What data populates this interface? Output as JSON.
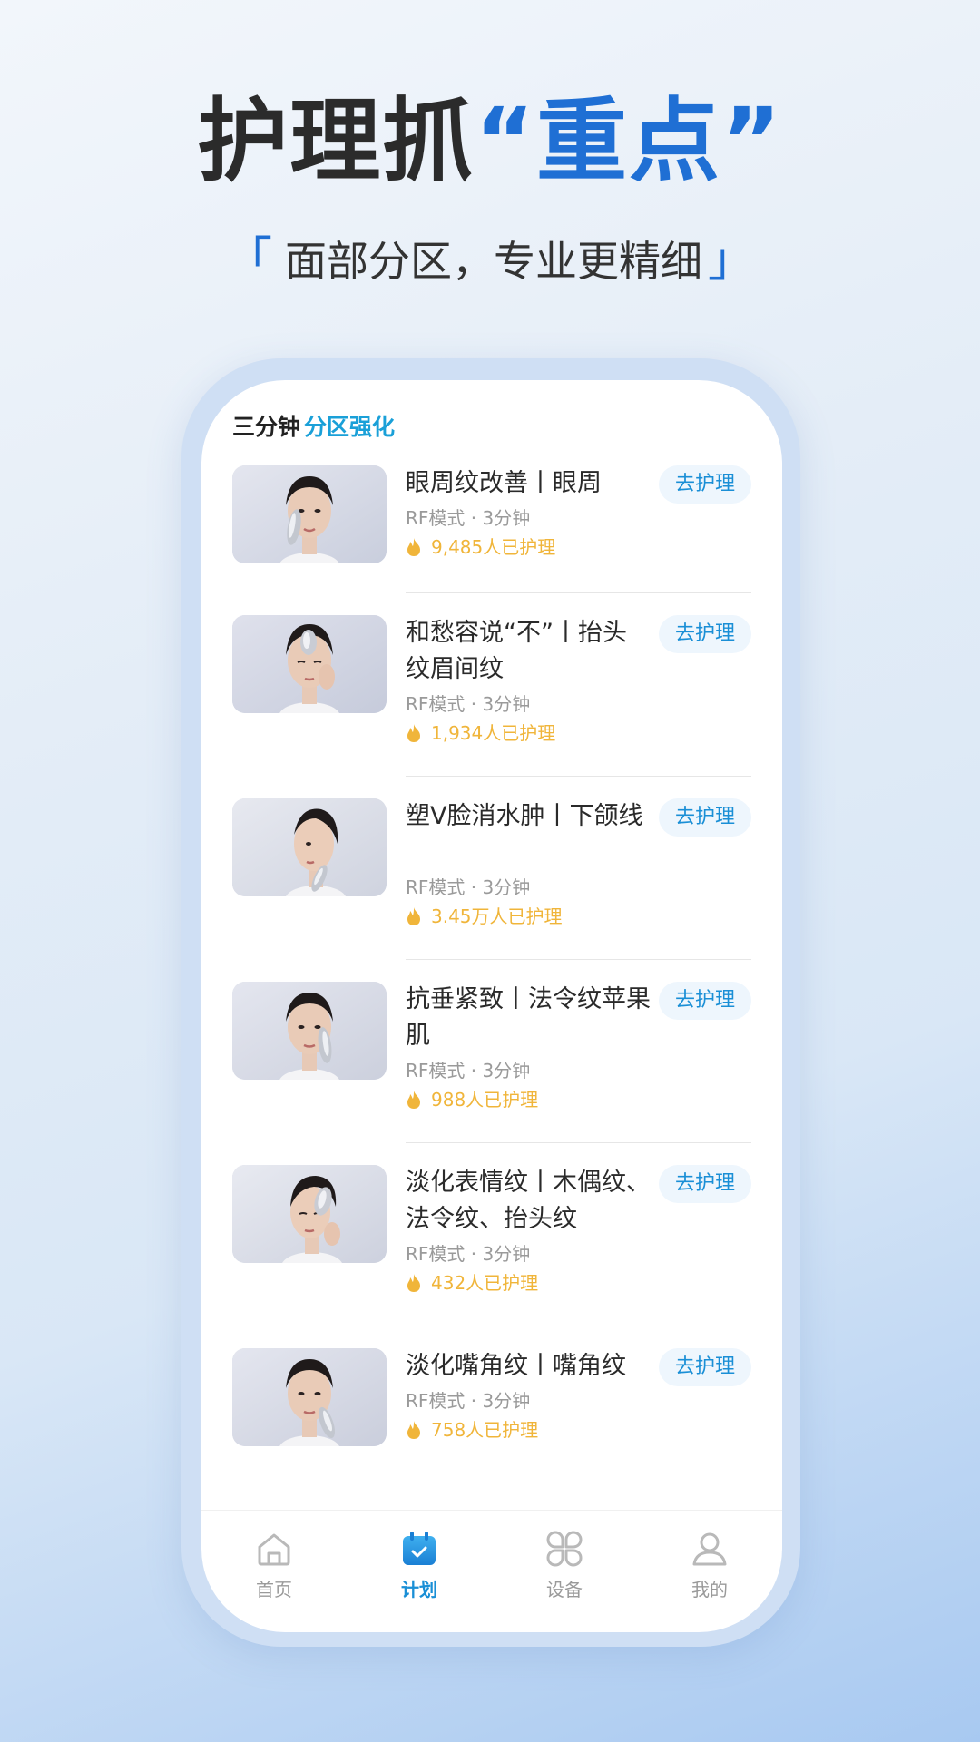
{
  "promo": {
    "title_main": "护理抓",
    "title_highlight": "“重点”",
    "subtitle_open": "「",
    "subtitle_text": "面部分区，专业更精细",
    "subtitle_close": "」"
  },
  "section": {
    "title_prefix": "三分钟",
    "title_accent": "分区强化"
  },
  "items": [
    {
      "title": "眼周纹改善丨眼周",
      "meta": "RF模式 · 3分钟",
      "count": "9,485人已护理",
      "button": "去护理"
    },
    {
      "title": "和愁容说“不”丨抬头纹眉间纹",
      "meta": "RF模式 · 3分钟",
      "count": "1,934人已护理",
      "button": "去护理"
    },
    {
      "title": "塑V脸消水肿丨下颌线",
      "meta": "RF模式 · 3分钟",
      "count": "3.45万人已护理",
      "button": "去护理"
    },
    {
      "title": "抗垂紧致丨法令纹苹果肌",
      "meta": "RF模式 · 3分钟",
      "count": "988人已护理",
      "button": "去护理"
    },
    {
      "title": "淡化表情纹丨木偶纹、法令纹、抬头纹",
      "meta": "RF模式 · 3分钟",
      "count": "432人已护理",
      "button": "去护理"
    },
    {
      "title": "淡化嘴角纹丨嘴角纹",
      "meta": "RF模式 · 3分钟",
      "count": "758人已护理",
      "button": "去护理"
    }
  ],
  "nav": {
    "home": "首页",
    "plan": "计划",
    "device": "设备",
    "mine": "我的",
    "active": "plan"
  },
  "colors": {
    "accent_blue": "#1f6fd4",
    "link_blue": "#1a8fd6",
    "count_orange": "#f0b53a"
  }
}
